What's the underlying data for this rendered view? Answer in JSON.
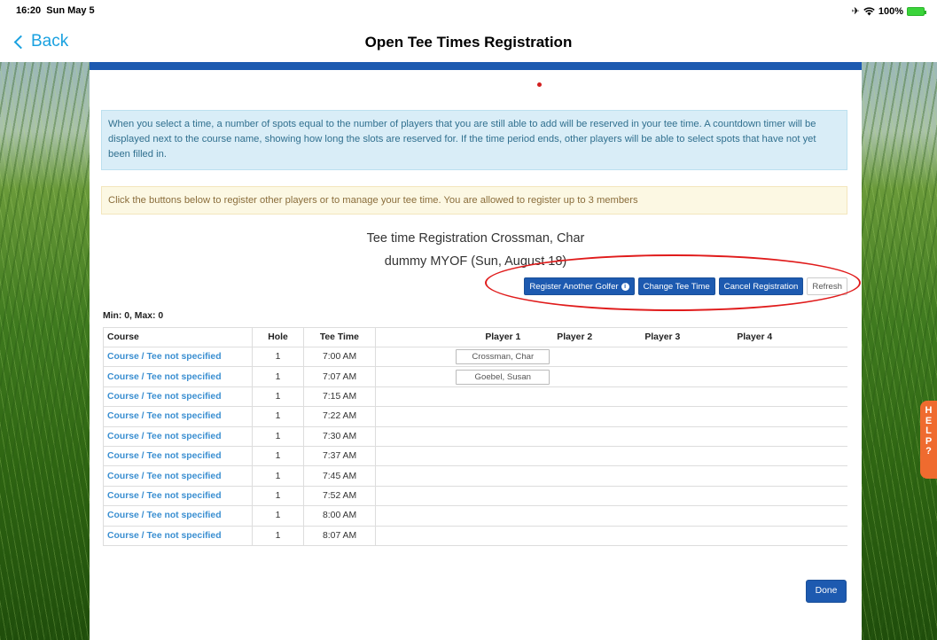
{
  "status": {
    "time": "16:20",
    "date": "Sun May 5",
    "battery": "100%",
    "airplane_icon": "airplane-icon",
    "wifi_icon": "wifi-icon"
  },
  "nav": {
    "back_label": "Back",
    "title": "Open Tee Times Registration"
  },
  "info_text": "When you select a time, a number of spots equal to the number of players that you are still able to add will be reserved in your tee time. A countdown timer will be displayed next to the course name, showing how long the slots are reserved for. If the time period ends, other players will be able to select spots that have not yet been filled in.",
  "warn_text": "Click the buttons below to register other players or to manage your tee time. You are allowed to register up to 3 members",
  "registration": {
    "title": "Tee time Registration Crossman, Char",
    "subtitle": "dummy MYOF (Sun, August 18)"
  },
  "buttons": {
    "register_another": "Register Another Golfer",
    "change_tee_time": "Change Tee Time",
    "cancel_registration": "Cancel Registration",
    "refresh": "Refresh",
    "done": "Done"
  },
  "minmax": "Min: 0, Max: 0",
  "table": {
    "headers": {
      "course": "Course",
      "hole": "Hole",
      "tee_time": "Tee Time",
      "p1": "Player 1",
      "p2": "Player 2",
      "p3": "Player 3",
      "p4": "Player 4"
    },
    "rows": [
      {
        "course": "Course / Tee not specified",
        "hole": "1",
        "time": "7:00 AM",
        "p1": "Crossman, Char"
      },
      {
        "course": "Course / Tee not specified",
        "hole": "1",
        "time": "7:07 AM",
        "p1": "Goebel, Susan"
      },
      {
        "course": "Course / Tee not specified",
        "hole": "1",
        "time": "7:15 AM",
        "p1": ""
      },
      {
        "course": "Course / Tee not specified",
        "hole": "1",
        "time": "7:22 AM",
        "p1": ""
      },
      {
        "course": "Course / Tee not specified",
        "hole": "1",
        "time": "7:30 AM",
        "p1": ""
      },
      {
        "course": "Course / Tee not specified",
        "hole": "1",
        "time": "7:37 AM",
        "p1": ""
      },
      {
        "course": "Course / Tee not specified",
        "hole": "1",
        "time": "7:45 AM",
        "p1": ""
      },
      {
        "course": "Course / Tee not specified",
        "hole": "1",
        "time": "7:52 AM",
        "p1": ""
      },
      {
        "course": "Course / Tee not specified",
        "hole": "1",
        "time": "8:00 AM",
        "p1": ""
      },
      {
        "course": "Course / Tee not specified",
        "hole": "1",
        "time": "8:07 AM",
        "p1": ""
      }
    ]
  },
  "help_letters": [
    "H",
    "E",
    "L",
    "P",
    "?"
  ],
  "colors": {
    "primary": "#1d5ab0",
    "link": "#3b8fd1",
    "back": "#1aa1e0",
    "help": "#ef6b2f",
    "annotation": "#e01b1b"
  }
}
